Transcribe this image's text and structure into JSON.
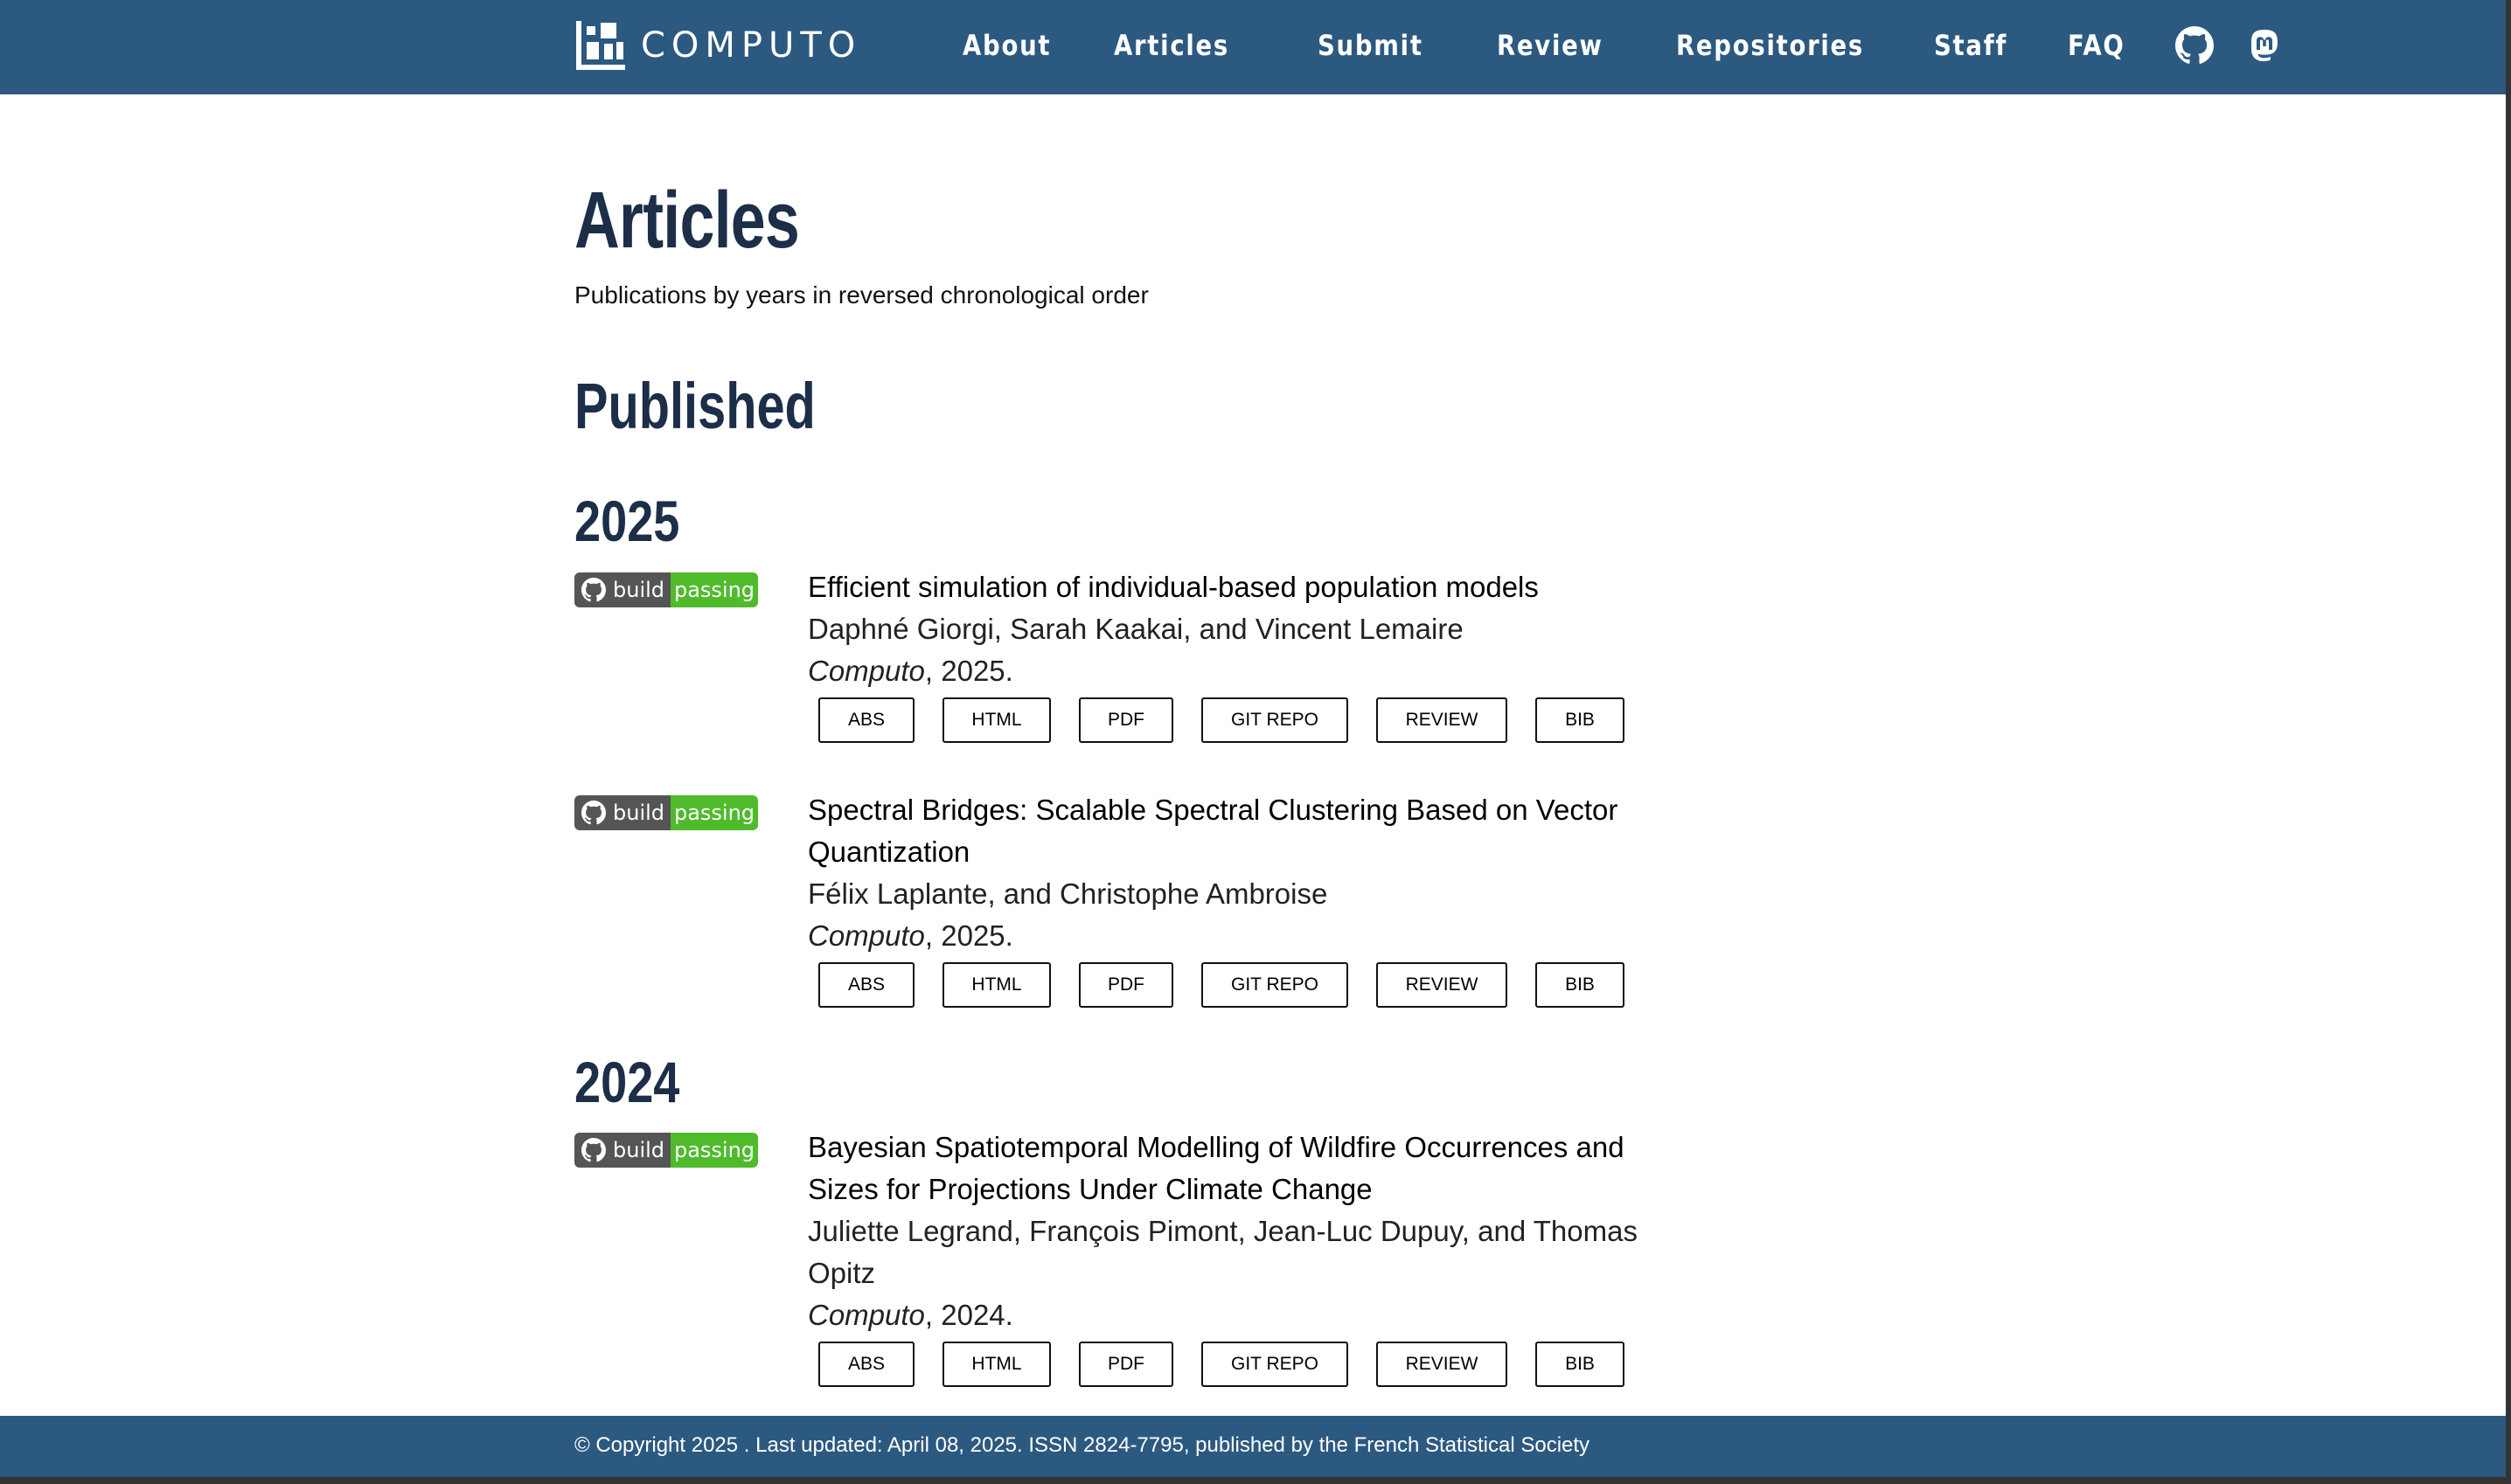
{
  "brand": {
    "name": "COMPUTO",
    "logo_icon": "computo-logo"
  },
  "nav": {
    "items": [
      "About",
      "Articles",
      "Submit",
      "Review",
      "Repositories",
      "Staff",
      "FAQ"
    ],
    "icons": [
      "github-icon",
      "mastodon-icon"
    ]
  },
  "page": {
    "title": "Articles",
    "subtitle": "Publications by years in reversed chronological order",
    "section": "Published"
  },
  "badge": {
    "left": "build",
    "right": "passing",
    "left_color": "#555555",
    "right_color": "#4fbb2b"
  },
  "years": [
    "2025",
    "2024"
  ],
  "articles": [
    {
      "title": "Efficient simulation of individual-based population models",
      "authors": "Daphné Giorgi, Sarah Kaakai, and Vincent Lemaire",
      "venue": "Computo",
      "year_text": ", 2025."
    },
    {
      "title": "Spectral Bridges: Scalable Spectral Clustering Based on Vector Quantization",
      "authors": "Félix Laplante, and Christophe Ambroise",
      "venue": "Computo",
      "year_text": ", 2025."
    },
    {
      "title": "Bayesian Spatiotemporal Modelling of Wildfire Occurrences and Sizes for Projections Under Climate Change",
      "authors": "Juliette Legrand, François Pimont, Jean-Luc Dupuy, and Thomas Opitz",
      "venue": "Computo",
      "year_text": ", 2024."
    }
  ],
  "buttons": {
    "abs": "ABS",
    "html": "HTML",
    "pdf": "PDF",
    "git": "GIT REPO",
    "review": "REVIEW",
    "bib": "BIB"
  },
  "footer": {
    "text": "© Copyright 2025 . Last updated: April 08, 2025. ISSN 2824-7795, published by the French Statistical Society"
  },
  "colors": {
    "navbar": "#2c5980",
    "heading": "#1c2e48"
  }
}
